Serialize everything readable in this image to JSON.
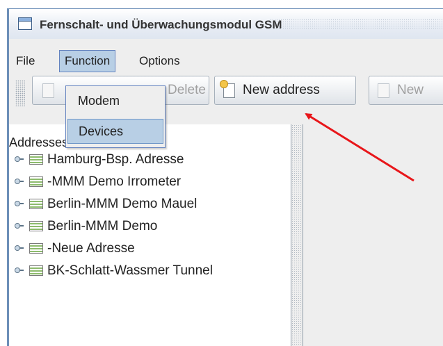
{
  "window": {
    "title": "Fernschalt- und Überwachungsmodul GSM"
  },
  "menubar": {
    "items": [
      "File",
      "Function",
      "Options"
    ]
  },
  "function_menu": {
    "items": [
      "Modem",
      "Devices"
    ]
  },
  "toolbar": {
    "delete_label": "Delete",
    "new_address_label": "New address",
    "new_label": "New"
  },
  "tree": {
    "root": "Addresses",
    "items": [
      "Hamburg-Bsp. Adresse",
      "-MMM Demo Irrometer",
      "Berlin-MMM Demo Mauel",
      "Berlin-MMM Demo",
      "-Neue Adresse",
      "BK-Schlatt-Wassmer Tunnel"
    ]
  },
  "annotation": {
    "arrow_color": "#e8161a"
  },
  "colors": {
    "menu_highlight": "#b8cfe5",
    "frame_border": "#6d8fb8"
  }
}
